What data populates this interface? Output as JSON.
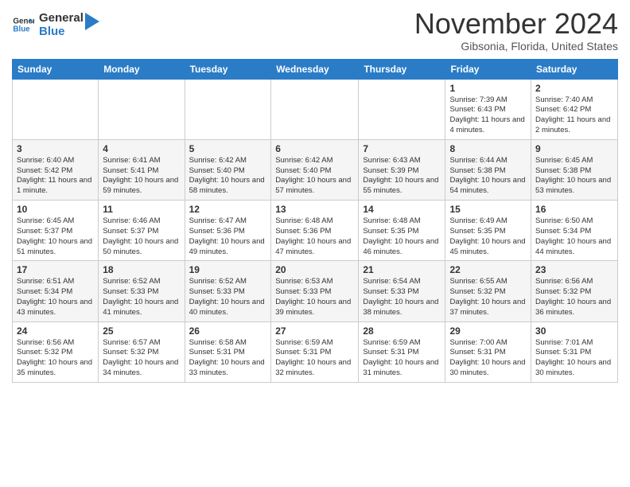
{
  "header": {
    "logo_line1": "General",
    "logo_line2": "Blue",
    "month": "November 2024",
    "location": "Gibsonia, Florida, United States"
  },
  "days_of_week": [
    "Sunday",
    "Monday",
    "Tuesday",
    "Wednesday",
    "Thursday",
    "Friday",
    "Saturday"
  ],
  "weeks": [
    [
      {
        "day": "",
        "info": ""
      },
      {
        "day": "",
        "info": ""
      },
      {
        "day": "",
        "info": ""
      },
      {
        "day": "",
        "info": ""
      },
      {
        "day": "",
        "info": ""
      },
      {
        "day": "1",
        "info": "Sunrise: 7:39 AM\nSunset: 6:43 PM\nDaylight: 11 hours and 4 minutes."
      },
      {
        "day": "2",
        "info": "Sunrise: 7:40 AM\nSunset: 6:42 PM\nDaylight: 11 hours and 2 minutes."
      }
    ],
    [
      {
        "day": "3",
        "info": "Sunrise: 6:40 AM\nSunset: 5:42 PM\nDaylight: 11 hours and 1 minute."
      },
      {
        "day": "4",
        "info": "Sunrise: 6:41 AM\nSunset: 5:41 PM\nDaylight: 10 hours and 59 minutes."
      },
      {
        "day": "5",
        "info": "Sunrise: 6:42 AM\nSunset: 5:40 PM\nDaylight: 10 hours and 58 minutes."
      },
      {
        "day": "6",
        "info": "Sunrise: 6:42 AM\nSunset: 5:40 PM\nDaylight: 10 hours and 57 minutes."
      },
      {
        "day": "7",
        "info": "Sunrise: 6:43 AM\nSunset: 5:39 PM\nDaylight: 10 hours and 55 minutes."
      },
      {
        "day": "8",
        "info": "Sunrise: 6:44 AM\nSunset: 5:38 PM\nDaylight: 10 hours and 54 minutes."
      },
      {
        "day": "9",
        "info": "Sunrise: 6:45 AM\nSunset: 5:38 PM\nDaylight: 10 hours and 53 minutes."
      }
    ],
    [
      {
        "day": "10",
        "info": "Sunrise: 6:45 AM\nSunset: 5:37 PM\nDaylight: 10 hours and 51 minutes."
      },
      {
        "day": "11",
        "info": "Sunrise: 6:46 AM\nSunset: 5:37 PM\nDaylight: 10 hours and 50 minutes."
      },
      {
        "day": "12",
        "info": "Sunrise: 6:47 AM\nSunset: 5:36 PM\nDaylight: 10 hours and 49 minutes."
      },
      {
        "day": "13",
        "info": "Sunrise: 6:48 AM\nSunset: 5:36 PM\nDaylight: 10 hours and 47 minutes."
      },
      {
        "day": "14",
        "info": "Sunrise: 6:48 AM\nSunset: 5:35 PM\nDaylight: 10 hours and 46 minutes."
      },
      {
        "day": "15",
        "info": "Sunrise: 6:49 AM\nSunset: 5:35 PM\nDaylight: 10 hours and 45 minutes."
      },
      {
        "day": "16",
        "info": "Sunrise: 6:50 AM\nSunset: 5:34 PM\nDaylight: 10 hours and 44 minutes."
      }
    ],
    [
      {
        "day": "17",
        "info": "Sunrise: 6:51 AM\nSunset: 5:34 PM\nDaylight: 10 hours and 43 minutes."
      },
      {
        "day": "18",
        "info": "Sunrise: 6:52 AM\nSunset: 5:33 PM\nDaylight: 10 hours and 41 minutes."
      },
      {
        "day": "19",
        "info": "Sunrise: 6:52 AM\nSunset: 5:33 PM\nDaylight: 10 hours and 40 minutes."
      },
      {
        "day": "20",
        "info": "Sunrise: 6:53 AM\nSunset: 5:33 PM\nDaylight: 10 hours and 39 minutes."
      },
      {
        "day": "21",
        "info": "Sunrise: 6:54 AM\nSunset: 5:33 PM\nDaylight: 10 hours and 38 minutes."
      },
      {
        "day": "22",
        "info": "Sunrise: 6:55 AM\nSunset: 5:32 PM\nDaylight: 10 hours and 37 minutes."
      },
      {
        "day": "23",
        "info": "Sunrise: 6:56 AM\nSunset: 5:32 PM\nDaylight: 10 hours and 36 minutes."
      }
    ],
    [
      {
        "day": "24",
        "info": "Sunrise: 6:56 AM\nSunset: 5:32 PM\nDaylight: 10 hours and 35 minutes."
      },
      {
        "day": "25",
        "info": "Sunrise: 6:57 AM\nSunset: 5:32 PM\nDaylight: 10 hours and 34 minutes."
      },
      {
        "day": "26",
        "info": "Sunrise: 6:58 AM\nSunset: 5:31 PM\nDaylight: 10 hours and 33 minutes."
      },
      {
        "day": "27",
        "info": "Sunrise: 6:59 AM\nSunset: 5:31 PM\nDaylight: 10 hours and 32 minutes."
      },
      {
        "day": "28",
        "info": "Sunrise: 6:59 AM\nSunset: 5:31 PM\nDaylight: 10 hours and 31 minutes."
      },
      {
        "day": "29",
        "info": "Sunrise: 7:00 AM\nSunset: 5:31 PM\nDaylight: 10 hours and 30 minutes."
      },
      {
        "day": "30",
        "info": "Sunrise: 7:01 AM\nSunset: 5:31 PM\nDaylight: 10 hours and 30 minutes."
      }
    ]
  ]
}
